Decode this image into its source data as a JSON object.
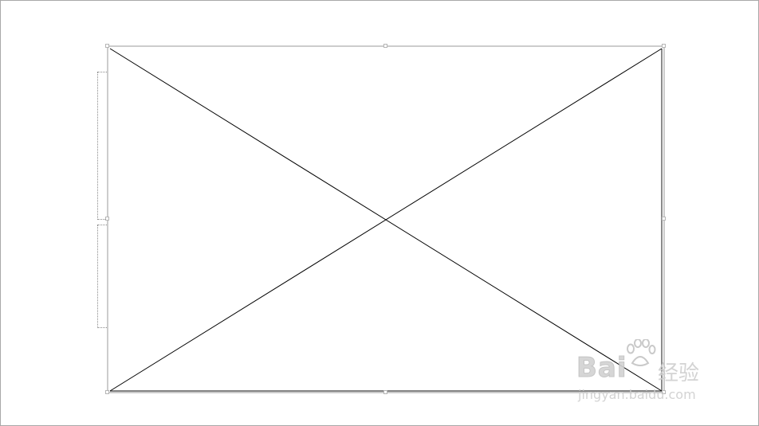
{
  "canvas": {
    "background": "#ffffff",
    "border_color": "#a8a8a8"
  },
  "image_placeholder": {
    "type": "empty-image-frame",
    "icon": "x-cross-placeholder-icon",
    "stroke_color": "#000000"
  },
  "watermark": {
    "brand": "Bai",
    "brand_suffix": "经验",
    "url": "jingyan.baidu.com",
    "icon": "paw-icon",
    "color": "#cfcfcf"
  }
}
